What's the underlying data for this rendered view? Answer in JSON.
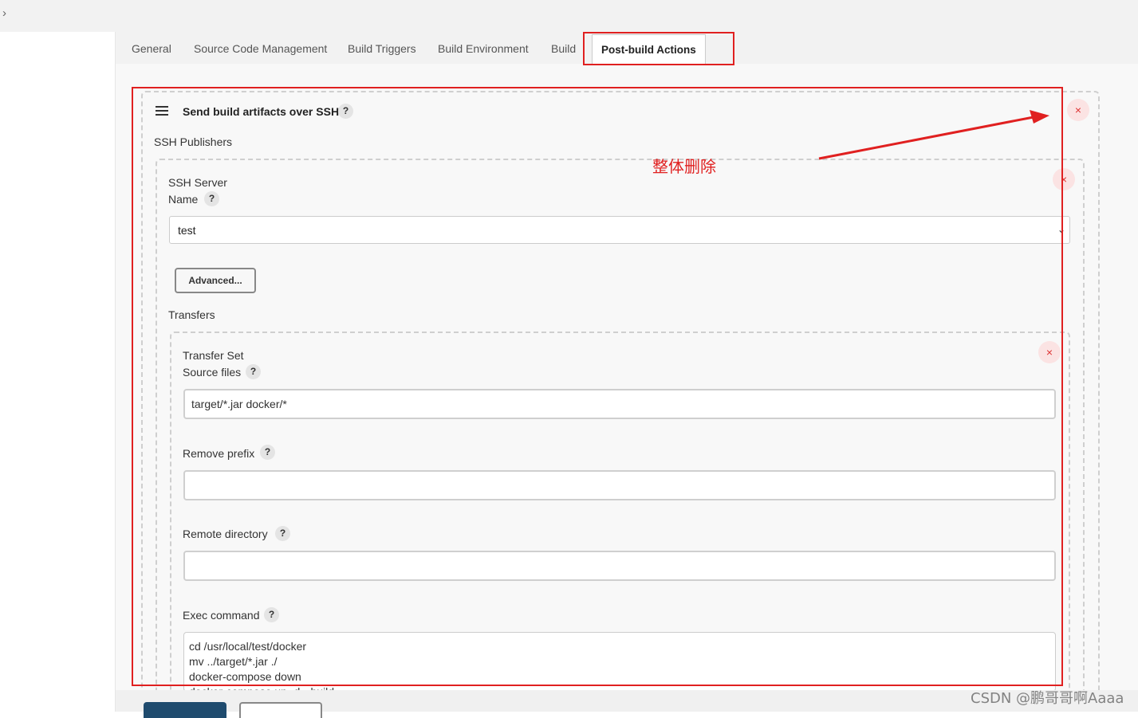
{
  "nav": {
    "expand_icon": "chevron-right-icon"
  },
  "tabs": [
    {
      "label": "General"
    },
    {
      "label": "Source Code Management"
    },
    {
      "label": "Build Triggers"
    },
    {
      "label": "Build Environment"
    },
    {
      "label": "Build"
    },
    {
      "label": "Post-build Actions",
      "active": true
    }
  ],
  "publisher": {
    "title": "Send build artifacts over SSH",
    "help": "?",
    "delete": "×",
    "ssh_publishers_label": "SSH Publishers",
    "server": {
      "section_label": "SSH Server",
      "name_label": "Name",
      "help": "?",
      "name_value": "test",
      "delete": "×",
      "advanced_button": "Advanced...",
      "transfers_label": "Transfers",
      "transfer_set": {
        "section_label": "Transfer Set",
        "delete": "×",
        "source_files_label": "Source files",
        "source_files_value": "target/*.jar docker/*",
        "remove_prefix_label": "Remove prefix",
        "remove_prefix_value": "",
        "remote_directory_label": "Remote directory",
        "remote_directory_value": "",
        "exec_command_label": "Exec command",
        "exec_command_lines": [
          "cd /usr/local/test/docker",
          "mv ../target/*.jar ./",
          "docker-compose down",
          "docker-compose up -d --build"
        ],
        "help": "?"
      }
    }
  },
  "annotation": {
    "text": "整体删除",
    "color": "#e02020"
  },
  "watermark": "CSDN @鹏哥哥啊Aaaa",
  "colors": {
    "primary_button": "#1f4b6e",
    "delete": "#d33",
    "annotation": "#e02020"
  }
}
